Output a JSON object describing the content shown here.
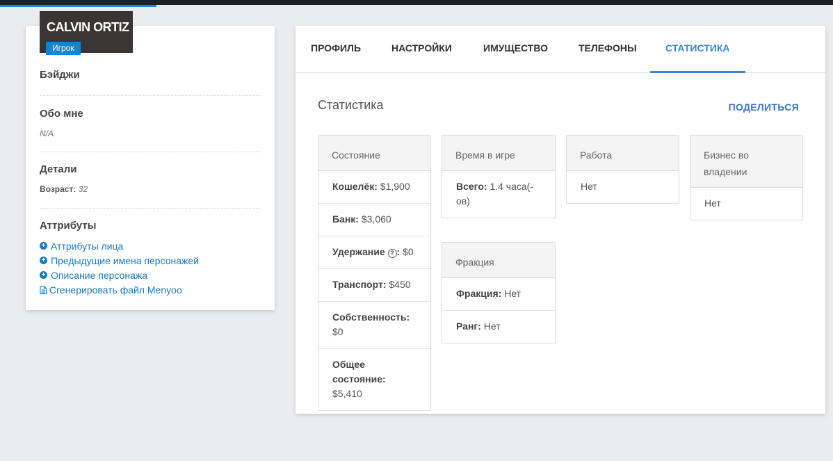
{
  "profile": {
    "name": "CALVIN ORTIZ",
    "role": "Игрок"
  },
  "sidebar": {
    "badges_title": "Бэйджи",
    "about_title": "Обо мне",
    "about_value": "N/A",
    "details_title": "Детали",
    "age_label": "Возраст:",
    "age_value": "32",
    "attributes_title": "Аттрибуты",
    "links": [
      {
        "label": "Аттрибуты лица",
        "icon": "plus-circle-icon"
      },
      {
        "label": "Предыдущие имена персонажей",
        "icon": "plus-circle-icon"
      },
      {
        "label": "Описание персонажа",
        "icon": "plus-circle-icon"
      },
      {
        "label": "Сгенерировать файл Menyoo",
        "icon": "file-icon"
      }
    ]
  },
  "tabs": [
    {
      "label": "ПРОФИЛЬ",
      "active": false
    },
    {
      "label": "НАСТРОЙКИ",
      "active": false
    },
    {
      "label": "ИМУЩЕСТВО",
      "active": false
    },
    {
      "label": "ТЕЛЕФОНЫ",
      "active": false
    },
    {
      "label": "СТАТИСТИКА",
      "active": true
    }
  ],
  "stats": {
    "title": "Статистика",
    "share_label": "ПОДЕЛИТЬСЯ",
    "state_panel": {
      "title": "Состояние",
      "rows": [
        {
          "label": "Кошелёк:",
          "value": "$1,900"
        },
        {
          "label": "Банк:",
          "value": "$3,060"
        },
        {
          "label": "Удержание",
          "value": "$0"
        },
        {
          "label": "Транспорт:",
          "value": "$450"
        },
        {
          "label": "Собственность:",
          "value": "$0"
        },
        {
          "label": "Общее состояние:",
          "value": "$5,410"
        }
      ]
    },
    "time_panel": {
      "title": "Время в игре",
      "rows": [
        {
          "label": "Всего:",
          "value": "1.4 часа(-ов)"
        }
      ]
    },
    "work_panel": {
      "title": "Работа",
      "rows": [
        {
          "value": "Нет"
        }
      ]
    },
    "business_panel": {
      "title": "Бизнес во владении",
      "rows": [
        {
          "value": "Нет"
        }
      ]
    },
    "faction_panel": {
      "title": "Фракция",
      "rows": [
        {
          "label": "Фракция:",
          "value": "Нет"
        },
        {
          "label": "Ранг:",
          "value": "Нет"
        }
      ]
    }
  },
  "colors": {
    "accent": "#3b86d6",
    "role_badge": "#0a88d6",
    "name_badge_bg": "#3b3434",
    "link": "#1a7bbf"
  }
}
